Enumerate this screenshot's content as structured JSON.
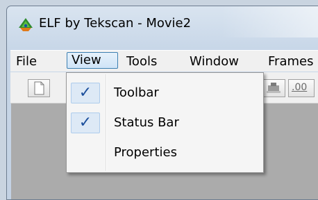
{
  "window": {
    "title": "ELF by Tekscan - Movie2",
    "icon": "elf-app-icon"
  },
  "menubar": {
    "items": [
      {
        "label": "File"
      },
      {
        "label": "View",
        "active": true
      },
      {
        "label": "Tools"
      },
      {
        "label": "Window"
      },
      {
        "label": "Frames"
      }
    ]
  },
  "toolbar": {
    "buttons": [
      {
        "icon": "new-document-icon"
      },
      {
        "icon": "stamp-icon"
      },
      {
        "icon": "decimal-format-icon",
        "label": ".00"
      }
    ]
  },
  "view_menu": {
    "items": [
      {
        "label": "Toolbar",
        "checked": true
      },
      {
        "label": "Status Bar",
        "checked": true
      },
      {
        "label": "Properties",
        "checked": false
      }
    ],
    "check_glyph": "✓"
  },
  "colors": {
    "check": "#1c4f9c",
    "highlight_border": "#3c7fb1",
    "content_bg": "#ababab"
  }
}
